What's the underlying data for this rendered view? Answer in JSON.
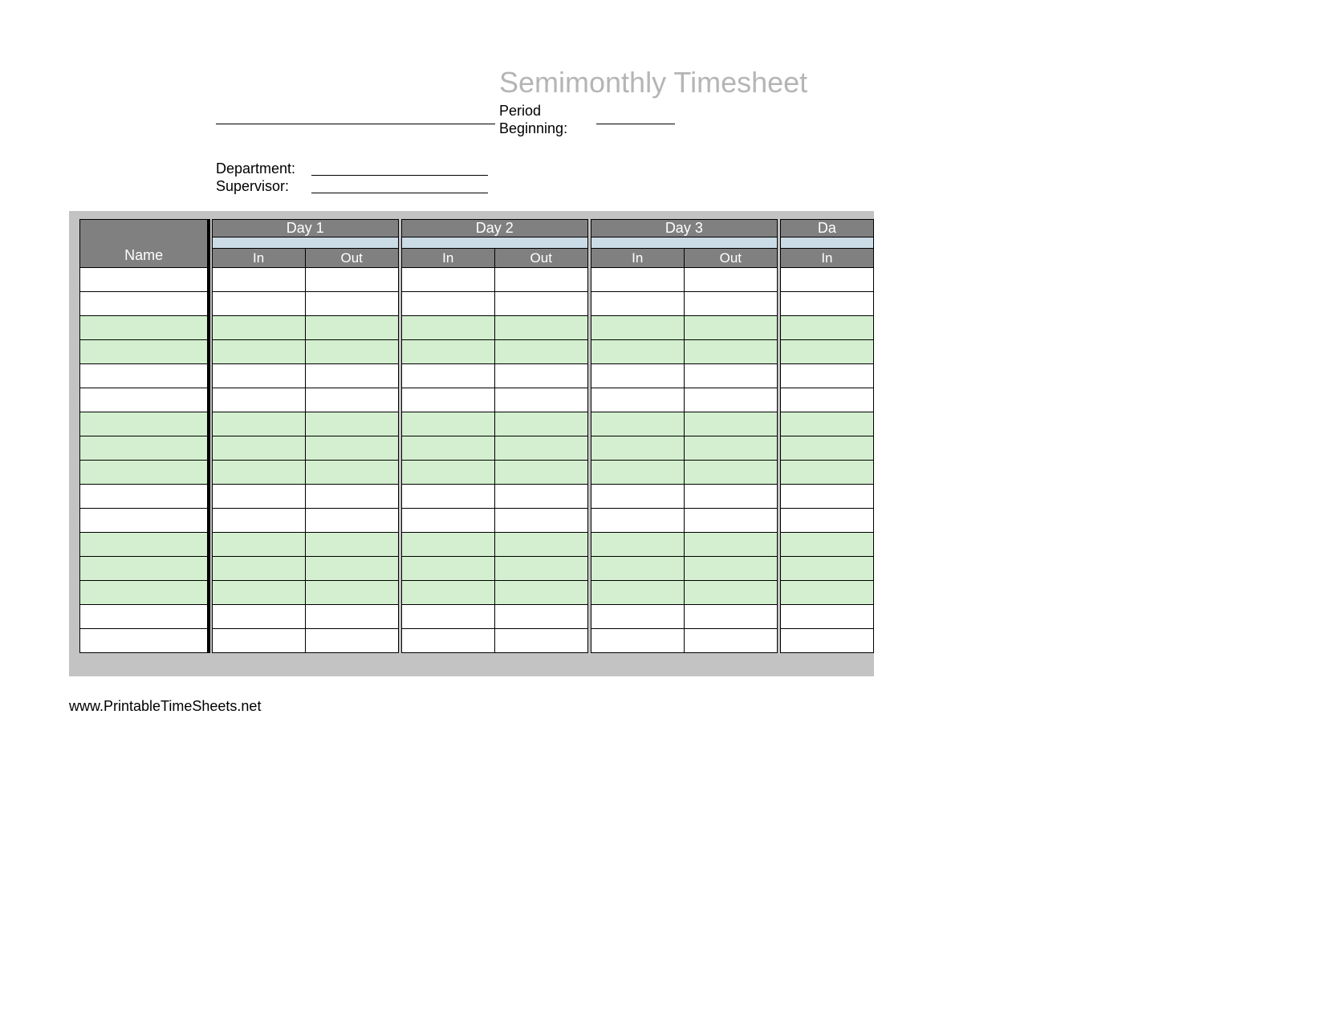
{
  "title": "Semimonthly Timesheet",
  "labels": {
    "period": "Period\nBeginning:",
    "department": "Department:",
    "supervisor": "Supervisor:"
  },
  "columns": {
    "name": "Name",
    "days": [
      "Day 1",
      "Day 2",
      "Day 3",
      "Da"
    ],
    "sub": {
      "in": "In",
      "out": "Out"
    }
  },
  "row_count": 16,
  "footer": "www.PrintableTimeSheets.net"
}
